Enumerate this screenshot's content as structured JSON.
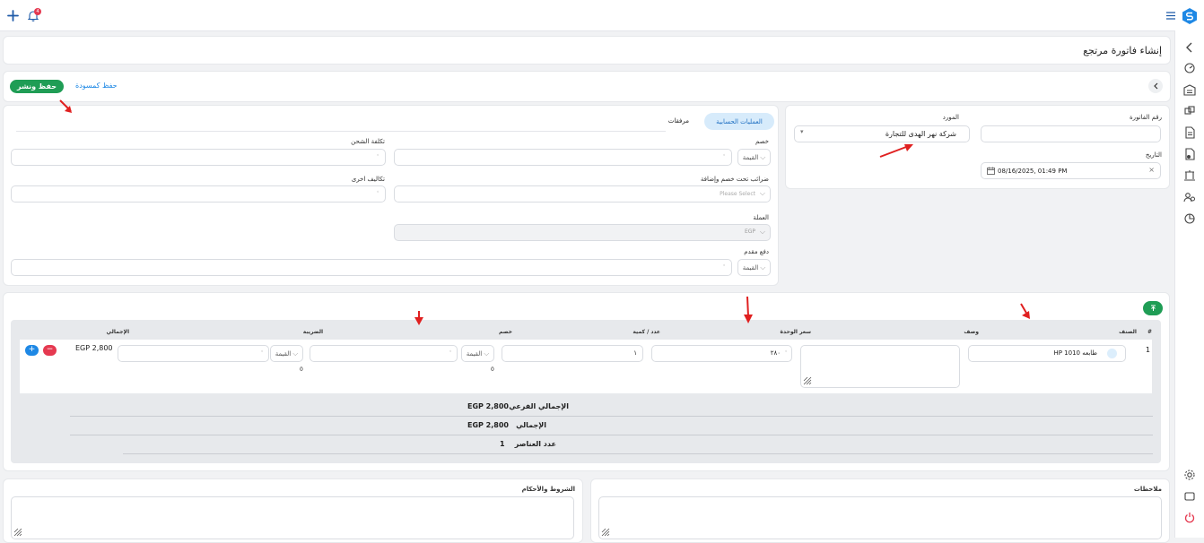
{
  "header": {
    "title": "إنشاء فاتورة مرتجع"
  },
  "topbar": {
    "notification_count": "4"
  },
  "toolbar": {
    "save_publish": "حفظ ونشر",
    "save_draft": "حفظ كمسودة"
  },
  "invoice": {
    "number_label": "رقم الفاتورة",
    "supplier_label": "المورد",
    "supplier_value": "شركة نهر الهدى للتجارة",
    "date_label": "التاريخ",
    "date_value": "08/16/2025, 01:49 PM"
  },
  "tabs": [
    {
      "label": "العمليات الحسابية"
    },
    {
      "label": "مرفقات"
    }
  ],
  "accounting": {
    "discount_label": "خصم",
    "shipping_label": "تكلفة الشحن",
    "taxes_label": "ضرائب تحت خصم وإضافة",
    "taxes_placeholder": "Please Select",
    "other_costs_label": "تكاليف اخرى",
    "currency_label": "العملة",
    "currency_value": "EGP",
    "advance_label": "دفع مقدم",
    "value_option": "القيمة"
  },
  "items_table": {
    "headers": {
      "num": "#",
      "item": "الصنف",
      "desc": "وصف",
      "unit_price": "سعر الوحدة",
      "qty": "عدد / كمية",
      "discount": "خصم",
      "tax": "الضريبة",
      "total": "الإجمالي"
    },
    "rows": [
      {
        "num": "1",
        "item": "طابعه HP 1010",
        "unit_price": "٢٨٠",
        "qty": "١",
        "discount_type": "القيمة",
        "discount_sub": "0",
        "tax_type": "القيمة",
        "tax_sub": "0",
        "total": "EGP 2,800"
      }
    ]
  },
  "totals": {
    "subtotal_label": "الإجمالي الفرعي",
    "subtotal_value": "EGP 2,800",
    "total_label": "الإجمالي",
    "total_value": "EGP 2,800",
    "count_label": "عدد العناصر",
    "count_value": "1"
  },
  "notes": {
    "label": "ملاحظات"
  },
  "terms": {
    "label": "الشروط والأحكام"
  },
  "colors": {
    "primary": "#1f9d55",
    "accent_blue": "#1e88e5",
    "danger": "#e53950",
    "arrow_red": "#e02020"
  }
}
